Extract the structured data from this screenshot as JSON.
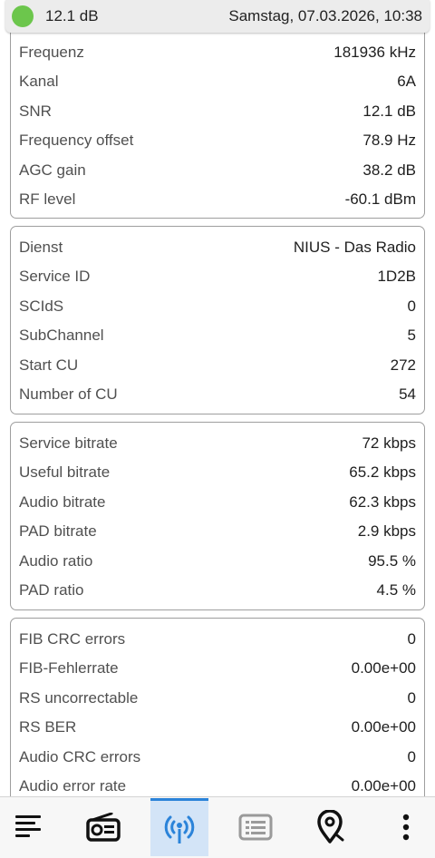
{
  "status": {
    "snr": "12.1 dB",
    "datetime": "Samstag, 07.03.2026, 10:38",
    "indicator_color": "#6cc64c"
  },
  "cards": [
    {
      "rows": [
        {
          "label": "Frequenz",
          "value": "181936 kHz"
        },
        {
          "label": "Kanal",
          "value": "6A"
        },
        {
          "label": "SNR",
          "value": "12.1 dB"
        },
        {
          "label": "Frequency offset",
          "value": "78.9 Hz"
        },
        {
          "label": "AGC gain",
          "value": "38.2 dB"
        },
        {
          "label": "RF level",
          "value": "-60.1 dBm"
        }
      ]
    },
    {
      "rows": [
        {
          "label": "Dienst",
          "value": "NIUS - Das Radio"
        },
        {
          "label": "Service ID",
          "value": "1D2B"
        },
        {
          "label": "SCIdS",
          "value": "0"
        },
        {
          "label": "SubChannel",
          "value": "5"
        },
        {
          "label": "Start CU",
          "value": "272"
        },
        {
          "label": "Number of CU",
          "value": "54"
        }
      ]
    },
    {
      "rows": [
        {
          "label": "Service bitrate",
          "value": "72 kbps"
        },
        {
          "label": "Useful bitrate",
          "value": "65.2 kbps"
        },
        {
          "label": "Audio bitrate",
          "value": "62.3 kbps"
        },
        {
          "label": "PAD bitrate",
          "value": "2.9 kbps"
        },
        {
          "label": "Audio ratio",
          "value": "95.5 %"
        },
        {
          "label": "PAD ratio",
          "value": "4.5 %"
        }
      ]
    },
    {
      "rows": [
        {
          "label": "FIB CRC errors",
          "value": "0"
        },
        {
          "label": "FIB-Fehlerrate",
          "value": "0.00e+00"
        },
        {
          "label": "RS uncorrectable",
          "value": "0"
        },
        {
          "label": "RS BER",
          "value": "0.00e+00"
        },
        {
          "label": "Audio CRC errors",
          "value": "0"
        },
        {
          "label": "Audio error rate",
          "value": "0.00e+00"
        }
      ]
    }
  ],
  "nav": {
    "items": [
      {
        "icon": "menu-lines-icon"
      },
      {
        "icon": "radio-icon"
      },
      {
        "icon": "signal-antenna-icon",
        "active": true
      },
      {
        "icon": "list-icon"
      },
      {
        "icon": "map-pin-icon"
      },
      {
        "icon": "more-vertical-icon"
      }
    ],
    "accent_color": "#2b83d9",
    "active_bg": "#d3e4f7"
  }
}
